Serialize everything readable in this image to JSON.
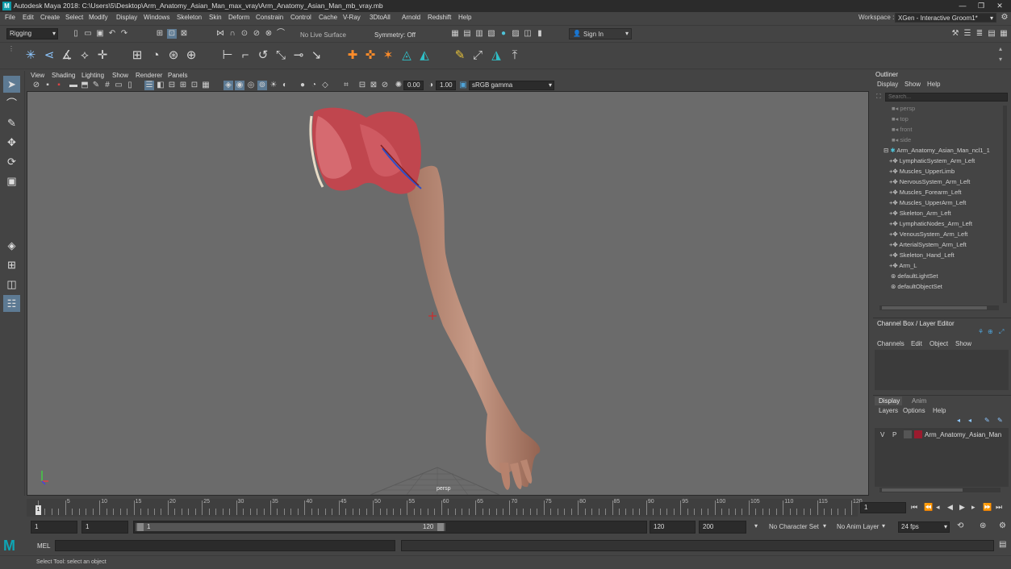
{
  "titlebar": {
    "title": "Autodesk Maya 2018: C:\\Users\\5\\Desktop\\Arm_Anatomy_Asian_Man_max_vray\\Arm_Anatomy_Asian_Man_mb_vray.mb",
    "logo": "M"
  },
  "menu": [
    "File",
    "Edit",
    "Create",
    "Select",
    "Modify",
    "Display",
    "Windows",
    "Skeleton",
    "Skin",
    "Deform",
    "Constrain",
    "Control",
    "Cache",
    "V-Ray",
    "3DtoAll",
    "Arnold",
    "Redshift",
    "Help"
  ],
  "workspace": {
    "label": "Workspace :",
    "value": "XGen - Interactive Groom1*"
  },
  "statusline": {
    "menuset": "Rigging",
    "live_surface": "No Live Surface",
    "symmetry": "Symmetry: Off",
    "sign_in": "Sign In"
  },
  "panel": {
    "menus": [
      "View",
      "Shading",
      "Lighting",
      "Show",
      "Renderer",
      "Panels"
    ],
    "exposure": "0.00",
    "gamma": "1.00",
    "color_space": "sRGB gamma",
    "camera_label": "persp"
  },
  "outliner": {
    "title": "Outliner",
    "menus": [
      "Display",
      "Show",
      "Help"
    ],
    "search_placeholder": "Search...",
    "cameras": [
      "persp",
      "top",
      "front",
      "side"
    ],
    "root": "Arm_Anatomy_Asian_Man_ncl1_1",
    "children": [
      "LymphaticSystem_Arm_Left",
      "Muscles_UpperLimb",
      "NervousSystem_Arm_Left",
      "Muscles_Forearm_Left",
      "Muscles_UpperArm_Left",
      "Skeleton_Arm_Left",
      "LymphaticNodes_Arm_Left",
      "VenousSystem_Arm_Left",
      "ArterialSystem_Arm_Left",
      "Skeleton_Hand_Left",
      "Arm_L"
    ],
    "sets": [
      "defaultLightSet",
      "defaultObjectSet"
    ]
  },
  "channelbox": {
    "title": "Channel Box / Layer Editor",
    "menus": [
      "Channels",
      "Edit",
      "Object",
      "Show"
    ]
  },
  "layers": {
    "tabs": [
      "Display",
      "Anim"
    ],
    "menus": [
      "Layers",
      "Options",
      "Help"
    ],
    "row": {
      "v": "V",
      "p": "P",
      "name": "Arm_Anatomy_Asian_Man",
      "color": "#9b1b2e"
    }
  },
  "timeline": {
    "ticks": [
      "1",
      "5",
      "10",
      "15",
      "20",
      "25",
      "30",
      "35",
      "40",
      "45",
      "50",
      "55",
      "60",
      "65",
      "70",
      "75",
      "80",
      "85",
      "90",
      "95",
      "100",
      "105",
      "110",
      "115",
      "120"
    ],
    "current_frame": "1"
  },
  "range": {
    "start": "1",
    "playback_start": "1",
    "slider_start": "1",
    "slider_end": "120",
    "playback_end": "120",
    "end": "200",
    "character_set": "No Character Set",
    "anim_layer": "No Anim Layer",
    "fps": "24 fps"
  },
  "command": {
    "lang": "MEL"
  },
  "help": {
    "text": "Select Tool: select an object"
  }
}
